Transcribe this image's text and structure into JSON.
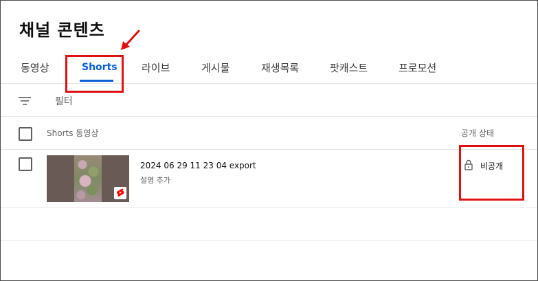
{
  "page": {
    "title": "채널 콘텐츠"
  },
  "tabs": [
    {
      "label": "동영상",
      "active": false
    },
    {
      "label": "Shorts",
      "active": true
    },
    {
      "label": "라이브",
      "active": false
    },
    {
      "label": "게시물",
      "active": false
    },
    {
      "label": "재생목록",
      "active": false
    },
    {
      "label": "팟캐스트",
      "active": false
    },
    {
      "label": "프로모션",
      "active": false
    }
  ],
  "filter": {
    "icon": "filter-icon",
    "label": "필터"
  },
  "table": {
    "columns": [
      "Shorts 동영상",
      "공개 상태"
    ],
    "rows": [
      {
        "title": "2024 06 29 11 23 04 export",
        "description": "설명 추가",
        "visibility": "비공개",
        "visibility_icon": "lock-icon",
        "badge_icon": "shorts-icon"
      }
    ]
  },
  "colors": {
    "accent": "#065fd4",
    "annotation": "#e01010",
    "shorts_red": "#ff0000"
  }
}
